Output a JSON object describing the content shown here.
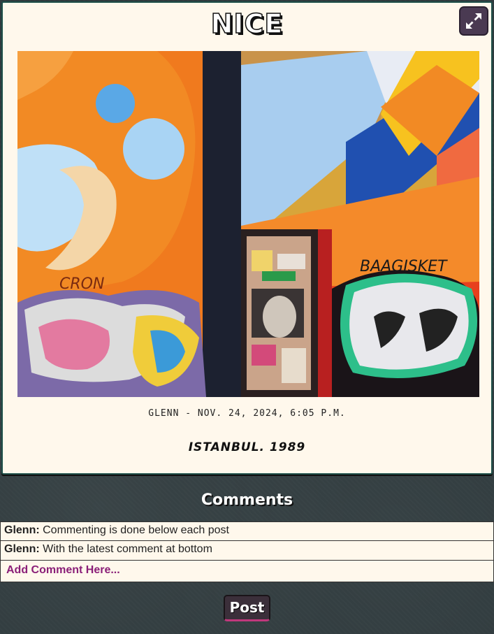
{
  "post": {
    "title": "NICE",
    "meta": "Glenn - Nov. 24, 2024, 6:05 p.m.",
    "caption": "Istanbul. 1989",
    "image_alt": "Colorful graffiti mural on brick wall with sticker-covered door",
    "expand_icon": "expand-arrows-icon"
  },
  "comments": {
    "heading": "Comments",
    "items": [
      {
        "author": "Glenn:",
        "text": "Commenting is done below each post"
      },
      {
        "author": "Glenn:",
        "text": "With the latest comment at bottom"
      }
    ],
    "placeholder": "Add Comment Here...",
    "post_label": "Post"
  },
  "colors": {
    "card_bg": "#fff8ec",
    "board_bg": "#2f3a3d",
    "accent": "#8a1f78",
    "button_bg": "#3b2f3a"
  }
}
